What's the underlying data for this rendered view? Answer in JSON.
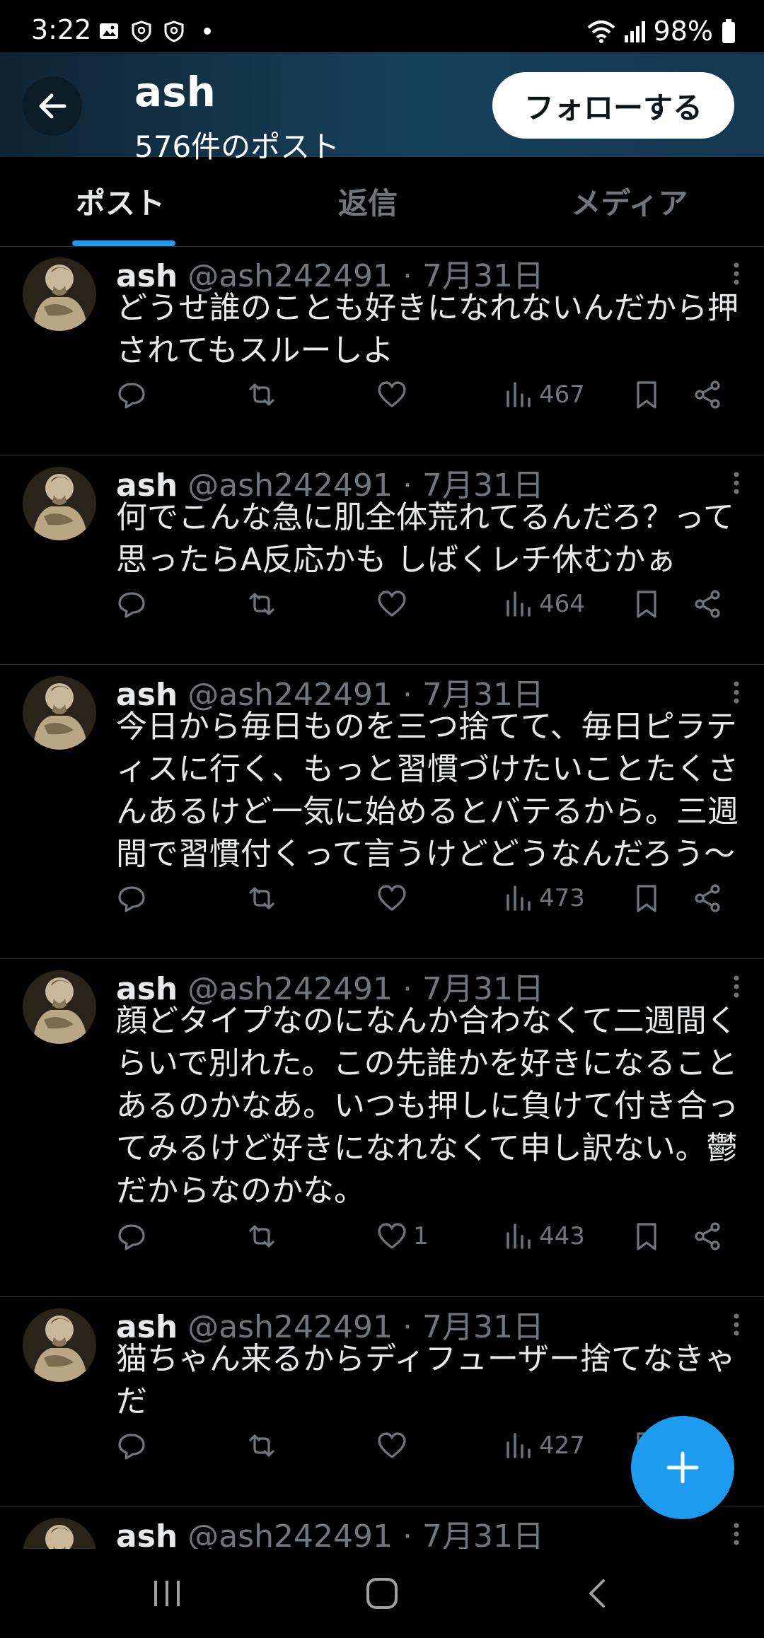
{
  "status_bar": {
    "time": "3:22",
    "battery": "98%"
  },
  "header": {
    "name": "ash",
    "post_count": "576件のポスト",
    "follow_label": "フォローする"
  },
  "tabs": [
    {
      "label": "ポスト"
    },
    {
      "label": "返信"
    },
    {
      "label": "メディア"
    }
  ],
  "posts": [
    {
      "name": "ash",
      "handle": "@ash242491",
      "date": "7月31日",
      "text": "どうせ誰のことも好きになれないんだから押\nされてもスルーしよ",
      "likes": "",
      "views": "467"
    },
    {
      "name": "ash",
      "handle": "@ash242491",
      "date": "7月31日",
      "text": "何でこんな急に肌全体荒れてるんだろ？って\n思ったらA反応かも しばくレチ休むかぁ",
      "likes": "",
      "views": "464"
    },
    {
      "name": "ash",
      "handle": "@ash242491",
      "date": "7月31日",
      "text": "今日から毎日ものを三つ捨てて、毎日ピラテ\nィスに行く、もっと習慣づけたいことたくさ\nんあるけど一気に始めるとバテるから。三週\n間で習慣付くって言うけどどうなんだろう〜",
      "likes": "",
      "views": "473"
    },
    {
      "name": "ash",
      "handle": "@ash242491",
      "date": "7月31日",
      "text": "顔どタイプなのになんか合わなくて二週間く\nらいで別れた。この先誰かを好きになること\nあるのかなあ。いつも押しに負けて付き合っ\nてみるけど好きになれなくて申し訳ない。鬱\nだからなのかな。",
      "likes": "1",
      "views": "443"
    },
    {
      "name": "ash",
      "handle": "@ash242491",
      "date": "7月31日",
      "text": "猫ちゃん来るからディフューザー捨てなきゃ\nだ",
      "likes": "",
      "views": "427"
    },
    {
      "name": "ash",
      "handle": "@ash242491",
      "date": "7月31日",
      "text": "",
      "likes": "",
      "views": ""
    }
  ],
  "colors": {
    "accent": "#1d9bf0",
    "muted": "#71767b",
    "background": "#000000"
  }
}
